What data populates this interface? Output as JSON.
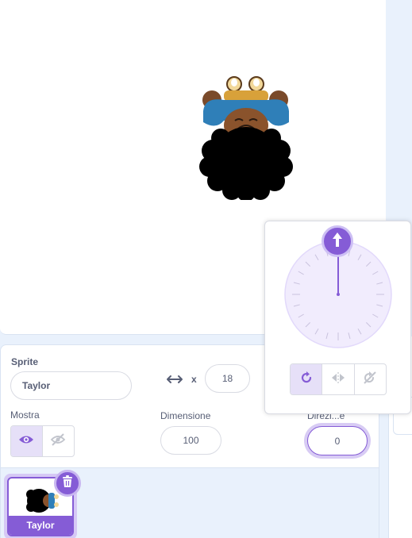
{
  "sprite_info": {
    "sprite_label": "Sprite",
    "sprite_name": "Taylor",
    "x_label": "x",
    "x_value": "18",
    "show_label": "Mostra",
    "size_label": "Dimensione",
    "size_value": "100",
    "direction_label": "Direzi...e",
    "direction_value": "0"
  },
  "sprite_list": {
    "items": [
      {
        "name": "Taylor",
        "selected": true
      }
    ]
  },
  "direction_popover": {
    "direction_value_shown": 0,
    "rotation_modes": [
      "all-around",
      "left-right",
      "dont-rotate"
    ],
    "active_mode": "all-around"
  },
  "colors": {
    "accent": "#855cd6",
    "accent_light": "#e6e0f8",
    "text": "#575e75",
    "pane_bg": "#e9f1fc",
    "border": "#d9dbe3"
  },
  "icons": {
    "x_axis": "arrows-horizontal-icon",
    "show": "eye-icon",
    "hide": "eye-slash-icon",
    "delete": "trash-icon",
    "dial_handle": "arrow-up-icon",
    "rotate_all": "rotate-all-around-icon",
    "rotate_lr": "left-right-flip-icon",
    "rotate_none": "dont-rotate-icon"
  }
}
